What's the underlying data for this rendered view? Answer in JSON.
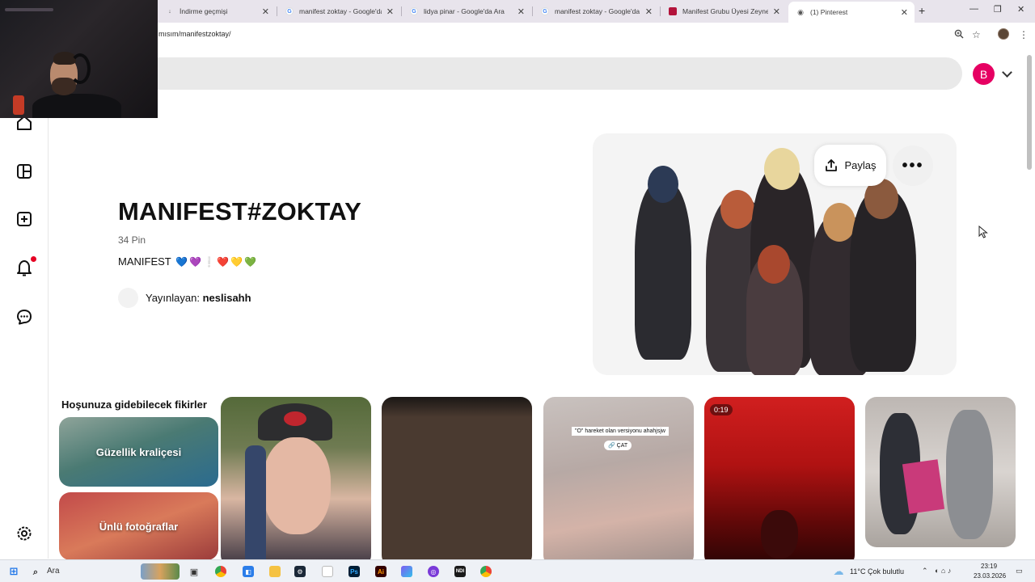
{
  "browser": {
    "tabs": [
      {
        "title": "İndirme geçmişi",
        "active": false
      },
      {
        "title": "manifest zoktay - Google'da Ara",
        "active": false
      },
      {
        "title": "lidya pinar - Google'da Ara",
        "active": false
      },
      {
        "title": "manifest zoktay - Google'da Ara",
        "active": false
      },
      {
        "title": "Manifest Grubu Üyesi Zeynep S",
        "active": false
      },
      {
        "title": "(1) Pinterest",
        "active": true
      }
    ],
    "url": "mısım/manifestzoktay/",
    "new_tab_label": "+"
  },
  "header": {
    "avatar_letter": "B",
    "accent_color": "#e60062"
  },
  "sidebar": {
    "items": [
      "home-icon",
      "grid-icon",
      "create-icon",
      "bell-icon",
      "chat-icon",
      "settings-icon"
    ]
  },
  "board": {
    "title": "MANIFEST#ZOKTAY",
    "pin_count": "34 Pin",
    "description_text": "MANIFEST",
    "description_emojis": [
      "💙",
      "💜",
      "❕",
      "❤️",
      "💛",
      "💚"
    ],
    "owner_prefix": "Yayınlayan:",
    "owner_name": "neslisahh",
    "share_label": "Paylaş",
    "more_label": "•••"
  },
  "ideas": {
    "title": "Hoşunuza gidebilecek fikirler",
    "items": [
      "Güzellik kraliçesi",
      "Ünlü fotoğraflar"
    ]
  },
  "pins": [
    {
      "kind": "image"
    },
    {
      "kind": "image"
    },
    {
      "kind": "video-text",
      "caption": "\"O\" hareket olan versiyonu ahahjsjw",
      "link": "ÇAT"
    },
    {
      "kind": "video",
      "duration": "0:19"
    },
    {
      "kind": "image"
    }
  ],
  "taskbar": {
    "search_label": "Ara",
    "weather": "11°C  Çok bulutlu",
    "time": "23:19",
    "date": "23.03.2026"
  }
}
